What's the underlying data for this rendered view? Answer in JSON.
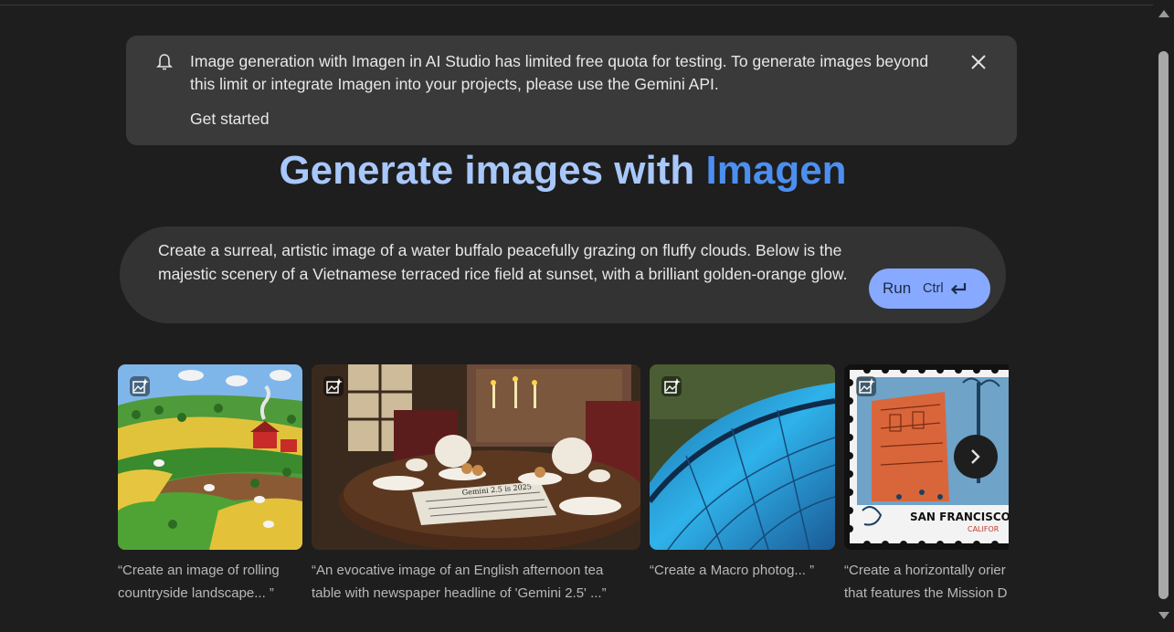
{
  "banner": {
    "message": "Image generation with Imagen in AI Studio has limited free quota for testing. To generate images beyond this limit or integrate Imagen into your projects, please use the Gemini API.",
    "link_label": "Get started"
  },
  "title": {
    "part1": "Generate images with ",
    "part2": "Imagen"
  },
  "prompt": {
    "text": "Create a surreal, artistic image of a water buffalo peacefully grazing on fluffy clouds. Below is the majestic scenery of a Vietnamese terraced rice field at sunset, with a brilliant golden-orange glow.",
    "run_label": "Run",
    "shortcut": "Ctrl"
  },
  "examples": [
    {
      "caption_line1": "“Create an image of rolling",
      "caption_line2": "countryside landscape... ”"
    },
    {
      "caption_line1": "“An evocative image of an English afternoon tea",
      "caption_line2": "table with newspaper headline of 'Gemini 2.5' ...”",
      "newspaper_text": "Gemini 2.5 is 2025"
    },
    {
      "caption_line1": "“Create a Macro photog... ”",
      "caption_line2": ""
    },
    {
      "caption_line1": "“Create a horizontally orier",
      "caption_line2": "that features the Mission D",
      "stamp_text": "SAN FRANCISCO",
      "stamp_subtext": "CALIFOR"
    }
  ],
  "icons": {
    "banner": "bell-icon",
    "close": "close-icon",
    "enter": "enter-key-icon",
    "image_badge": "image-sparkle-icon",
    "next": "chevron-right-icon"
  },
  "colors": {
    "title_light": "#a8c7fa",
    "title_blue": "#4d8ff0",
    "run_button": "#87a9ff"
  }
}
